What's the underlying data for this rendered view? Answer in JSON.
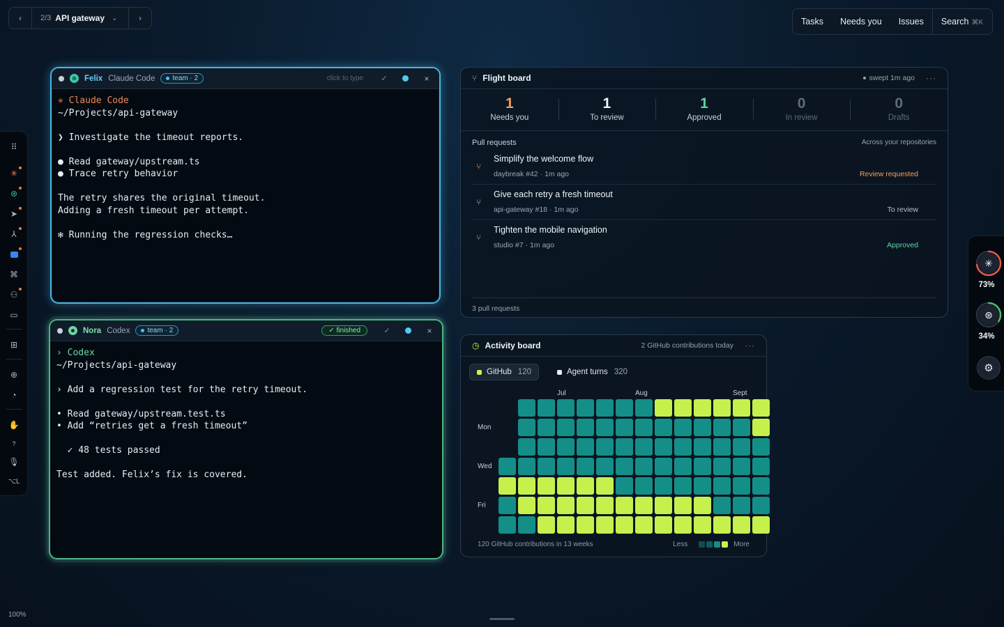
{
  "breadcrumb": {
    "position": "2/3",
    "name": "API gateway"
  },
  "topmenu": {
    "items": [
      "Tasks",
      "Needs you",
      "Issues"
    ],
    "search": "Search",
    "search_kbd": "⌘K"
  },
  "left_dock_icons": [
    "grip-icon",
    "claude-icon",
    "openai-icon",
    "cursor-icon",
    "agent-icon",
    "gemini-icon",
    "command-icon",
    "people-icon",
    "folder-icon",
    "grid-icon",
    "layout-icon",
    "palette-icon",
    "hand-icon",
    "help-icon",
    "mic-icon",
    "option-icon"
  ],
  "right_dock": {
    "claude_usage": "73%",
    "openai_usage": "34%",
    "claude_fraction": 0.73,
    "openai_fraction": 0.34
  },
  "felix": {
    "name": "Felix",
    "tool": "Claude Code",
    "team": "team · 2",
    "hint": "click to type",
    "lines": [
      "✳ Claude Code",
      "~/Projects/api-gateway",
      "",
      "❯ Investigate the timeout reports.",
      "",
      "● Read gateway/upstream.ts",
      "● Trace retry behavior",
      "",
      "The retry shares the original timeout.",
      "Adding a fresh timeout per attempt.",
      "",
      "✻ Running the regression checks…"
    ]
  },
  "nora": {
    "name": "Nora",
    "tool": "Codex",
    "team": "team · 2",
    "status": "✓ finished",
    "lines": [
      "› Codex",
      "~/Projects/api-gateway",
      "",
      "› Add a regression test for the retry timeout.",
      "",
      "• Read gateway/upstream.test.ts",
      "• Add “retries get a fresh timeout”",
      "",
      "  ✓ 48 tests passed",
      "",
      "Test added. Felix’s fix is covered."
    ]
  },
  "flight": {
    "title": "Flight board",
    "meta": "swept 1m ago",
    "stats": [
      {
        "n": "1",
        "label": "Needs you",
        "color": "#f2a15d"
      },
      {
        "n": "1",
        "label": "To review",
        "color": "#f1f5f9"
      },
      {
        "n": "1",
        "label": "Approved",
        "color": "#5fd6a0"
      },
      {
        "n": "0",
        "label": "In review",
        "color": "#5d6c7b"
      },
      {
        "n": "0",
        "label": "Drafts",
        "color": "#5d6c7b"
      }
    ],
    "pr_header": "Pull requests",
    "pr_scope": "Across your repositories",
    "prs": [
      {
        "title": "Simplify the welcome flow",
        "repo": "daybreak #42",
        "time": "1m ago",
        "status": "Review requested",
        "color": "#f2a15d"
      },
      {
        "title": "Give each retry a fresh timeout",
        "repo": "api-gateway #18",
        "time": "1m ago",
        "status": "To review",
        "color": "#b7c2ce"
      },
      {
        "title": "Tighten the mobile navigation",
        "repo": "studio #7",
        "time": "1m ago",
        "status": "Approved",
        "color": "#5fd6a0"
      }
    ],
    "footer": "3 pull requests"
  },
  "activity": {
    "title": "Activity board",
    "meta": "2 GitHub contributions today",
    "tabs": [
      {
        "label": "GitHub",
        "count": "120",
        "color": "#d4f24a"
      },
      {
        "label": "Agent turns",
        "count": "320",
        "color": "#e7edf3"
      }
    ],
    "months": [
      {
        "label": "Jul",
        "week": 3
      },
      {
        "label": "Aug",
        "week": 7
      },
      {
        "label": "Sept",
        "week": 12
      }
    ],
    "days": [
      {
        "label": "Mon",
        "row": 1
      },
      {
        "label": "Wed",
        "row": 3
      },
      {
        "label": "Fri",
        "row": 5
      }
    ],
    "levels": [
      [
        0,
        2,
        2,
        2,
        2,
        2,
        2,
        2,
        3,
        3,
        3,
        3,
        3,
        3
      ],
      [
        0,
        2,
        2,
        2,
        2,
        2,
        2,
        2,
        2,
        2,
        2,
        2,
        2,
        3
      ],
      [
        0,
        2,
        2,
        2,
        2,
        2,
        2,
        2,
        2,
        2,
        2,
        2,
        2,
        2
      ],
      [
        2,
        2,
        2,
        2,
        2,
        2,
        2,
        2,
        2,
        2,
        2,
        2,
        2,
        2
      ],
      [
        3,
        3,
        3,
        3,
        3,
        3,
        2,
        2,
        2,
        2,
        2,
        2,
        2,
        2
      ],
      [
        2,
        3,
        3,
        3,
        3,
        3,
        3,
        3,
        3,
        3,
        3,
        2,
        2,
        2
      ],
      [
        2,
        2,
        3,
        3,
        3,
        3,
        3,
        3,
        3,
        3,
        3,
        3,
        3,
        3
      ]
    ],
    "palette": [
      "#0b151f",
      "#0f5c5e",
      "#138f88",
      "#c6f04c"
    ],
    "footer": "120 GitHub contributions in 13 weeks",
    "less": "Less",
    "more": "More"
  },
  "zoom": "100%"
}
